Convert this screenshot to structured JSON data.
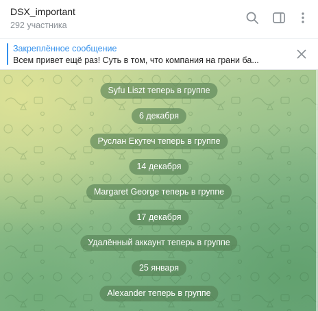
{
  "header": {
    "title": "DSX_important",
    "subtitle": "292 участника",
    "icons": [
      "search-icon",
      "sidebar-toggle-icon",
      "more-vertical-icon"
    ]
  },
  "pinned": {
    "title": "Закреплённое сообщение",
    "text": "Всем привет ещё раз!  Суть в том, что компания на грани ба..."
  },
  "messages": [
    {
      "type": "service",
      "text": "Syfu Liszt теперь в группе"
    },
    {
      "type": "date",
      "text": "6 декабря"
    },
    {
      "type": "service",
      "text": "Руслан Екутеч теперь в группе"
    },
    {
      "type": "date",
      "text": "14 декабря"
    },
    {
      "type": "service",
      "text": "Margaret George теперь в группе"
    },
    {
      "type": "date",
      "text": "17 декабря"
    },
    {
      "type": "service",
      "text": "Удалённый аккаунт теперь в группе"
    },
    {
      "type": "date",
      "text": "25 января"
    },
    {
      "type": "service",
      "text": "Alexander теперь в группе"
    }
  ],
  "colors": {
    "accent": "#3390ec",
    "service_pill": "#56805a"
  }
}
